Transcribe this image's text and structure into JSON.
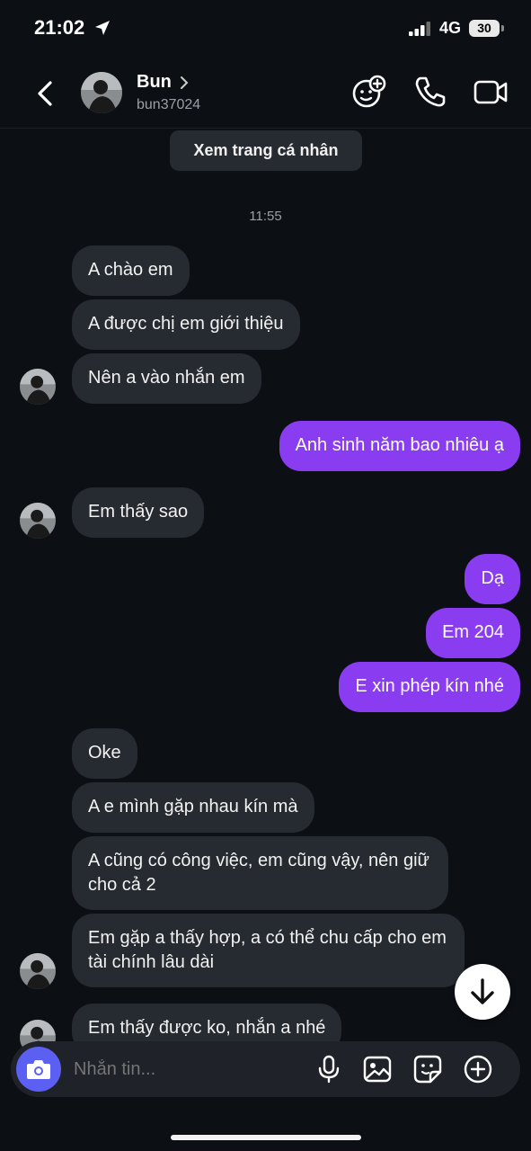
{
  "status": {
    "time": "21:02",
    "network": "4G",
    "battery": "30"
  },
  "header": {
    "name": "Bun",
    "username": "bun37024"
  },
  "profile_button": "Xem trang cá nhân",
  "timestamp": "11:55",
  "messages": [
    {
      "dir": "in",
      "text": "A chào em"
    },
    {
      "dir": "in",
      "text": "A được chị em giới thiệu"
    },
    {
      "dir": "in",
      "text": "Nên a vào nhắn em"
    },
    {
      "dir": "out",
      "text": "Anh sinh năm bao nhiêu ạ"
    },
    {
      "dir": "in",
      "text": "Em thấy sao"
    },
    {
      "dir": "out",
      "text": "Dạ"
    },
    {
      "dir": "out",
      "text": "Em 204"
    },
    {
      "dir": "out",
      "text": "E xin phép kín nhé"
    },
    {
      "dir": "in",
      "text": "Oke"
    },
    {
      "dir": "in",
      "text": "A e mình gặp nhau kín mà"
    },
    {
      "dir": "in",
      "text": "A cũng có công việc, em cũng vậy, nên giữ cho cả 2"
    },
    {
      "dir": "in",
      "text": "Em gặp a thấy hợp, a có thể chu cấp cho em tài chính lâu dài"
    },
    {
      "dir": "in",
      "text": "Em thấy được ko, nhắn a nhé"
    }
  ],
  "composer": {
    "placeholder": "Nhắn tin..."
  },
  "colors": {
    "background": "#0c0f14",
    "incoming": "#262a31",
    "outgoing": "#8a3cf0",
    "camera": "#5b5ff2"
  },
  "icons": [
    "location-arrow-icon",
    "signal-icon",
    "back-chevron-icon",
    "chevron-right-icon",
    "add-people-icon",
    "phone-icon",
    "video-icon",
    "arrow-down-icon",
    "camera-icon",
    "microphone-icon",
    "image-icon",
    "sticker-icon",
    "plus-circle-icon"
  ]
}
